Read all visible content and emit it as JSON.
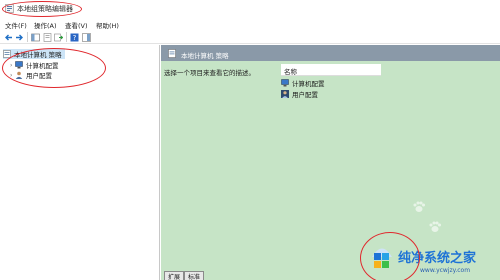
{
  "window": {
    "title": "本地组策略编辑器"
  },
  "menu": {
    "items": [
      "文件(F)",
      "操作(A)",
      "查看(V)",
      "帮助(H)"
    ]
  },
  "tree": {
    "root": "本地计算机 策略",
    "children": [
      "计算机配置",
      "用户配置"
    ]
  },
  "main": {
    "header": "本地计算机 策略",
    "description": "选择一个项目来查看它的描述。",
    "column_name": "名称",
    "items": [
      "计算机配置",
      "用户配置"
    ]
  },
  "tabs": [
    "扩展",
    "标准"
  ],
  "watermark": {
    "title": "纯净系统之家",
    "url": "www.ycwjzy.com"
  },
  "colors": {
    "accent_red": "#e0282d",
    "header_bg": "#8a99a8",
    "content_bg": "#c6e4c6",
    "brand_blue": "#1e73d6"
  }
}
